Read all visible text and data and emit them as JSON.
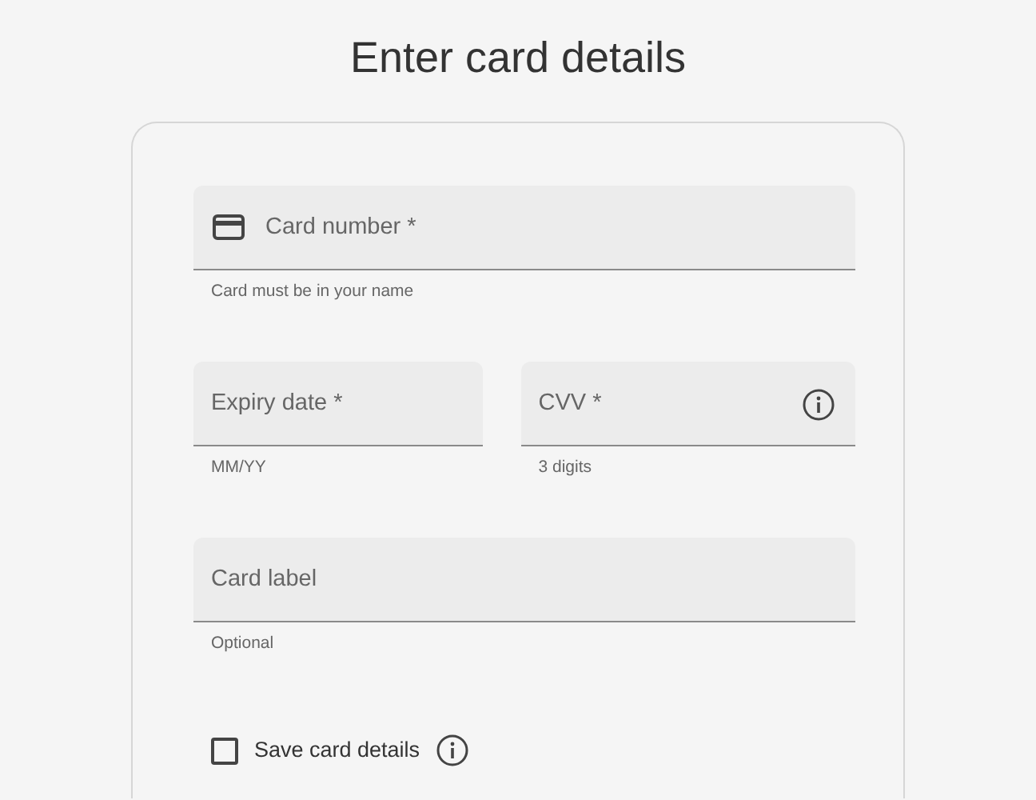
{
  "title": "Enter card details",
  "rows": [
    [
      {
        "placeholder": "Card number *",
        "hint": "Card must be in your name",
        "kind": "payment"
      }
    ],
    [
      {
        "placeholder": "Expiry date *",
        "hint": "MM/YY",
        "kind": "plain"
      },
      {
        "placeholder": "CVV *",
        "hint": "3 digits",
        "kind": "help"
      }
    ],
    [
      {
        "placeholder": "Card label",
        "hint": "Optional",
        "kind": "plain"
      }
    ]
  ],
  "save_card": {
    "label": "Save card details",
    "checked": false
  }
}
